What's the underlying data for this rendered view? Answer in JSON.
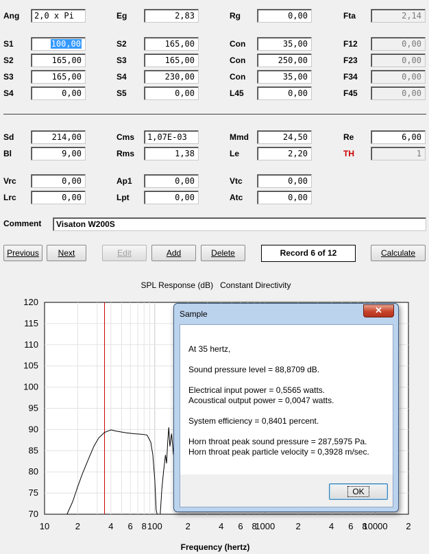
{
  "form": {
    "rows": [
      [
        {
          "label": "Ang",
          "value": "2,0 x Pi",
          "align": "left"
        },
        {
          "label": "Eg",
          "value": "2,83"
        },
        {
          "label": "Rg",
          "value": "0,00"
        },
        {
          "label": "Fta",
          "value": "2,14",
          "readonly": true
        }
      ],
      [
        {
          "label": "S1",
          "value": "100,00",
          "selected": true
        },
        {
          "label": "S2",
          "value": "165,00"
        },
        {
          "label": "Con",
          "value": "35,00"
        },
        {
          "label": "F12",
          "value": "0,00",
          "readonly": true
        }
      ],
      [
        {
          "label": "S2",
          "value": "165,00"
        },
        {
          "label": "S3",
          "value": "165,00"
        },
        {
          "label": "Con",
          "value": "250,00"
        },
        {
          "label": "F23",
          "value": "0,00",
          "readonly": true
        }
      ],
      [
        {
          "label": "S3",
          "value": "165,00"
        },
        {
          "label": "S4",
          "value": "230,00"
        },
        {
          "label": "Con",
          "value": "35,00"
        },
        {
          "label": "F34",
          "value": "0,00",
          "readonly": true
        }
      ],
      [
        {
          "label": "S4",
          "value": "0,00"
        },
        {
          "label": "S5",
          "value": "0,00"
        },
        {
          "label": "L45",
          "value": "0,00"
        },
        {
          "label": "F45",
          "value": "0,00",
          "readonly": true
        }
      ],
      [
        {
          "label": "Sd",
          "value": "214,00"
        },
        {
          "label": "Cms",
          "value": "1,07E-03",
          "align": "left"
        },
        {
          "label": "Mmd",
          "value": "24,50"
        },
        {
          "label": "Re",
          "value": "6,00"
        }
      ],
      [
        {
          "label": "Bl",
          "value": "9,00"
        },
        {
          "label": "Rms",
          "value": "1,38"
        },
        {
          "label": "Le",
          "value": "2,20"
        },
        {
          "label": "TH",
          "value": "1",
          "readonly": true,
          "red": true
        }
      ],
      [
        {
          "label": "Vrc",
          "value": "0,00"
        },
        {
          "label": "Ap1",
          "value": "0,00"
        },
        {
          "label": "Vtc",
          "value": "0,00"
        }
      ],
      [
        {
          "label": "Lrc",
          "value": "0,00"
        },
        {
          "label": "Lpt",
          "value": "0,00"
        },
        {
          "label": "Atc",
          "value": "0,00"
        }
      ]
    ],
    "comment_label": "Comment",
    "comment_value": "Visaton W200S"
  },
  "buttons": {
    "previous": "Previous",
    "next": "Next",
    "edit": "Edit",
    "add": "Add",
    "delete": "Delete",
    "record": "Record 6 of 12",
    "calculate": "Calculate"
  },
  "chart_data": {
    "type": "line",
    "title": "SPL Response (dB)   Constant Directivity",
    "xlabel": "Frequency (hertz)",
    "ylabel": "",
    "x_scale": "log",
    "xlim": [
      10,
      20000
    ],
    "ylim": [
      70,
      120
    ],
    "y_ticks": [
      120,
      115,
      110,
      105,
      100,
      95,
      90,
      85,
      80,
      75,
      70
    ],
    "x_tick_labels": [
      {
        "x": 10,
        "label": "10"
      },
      {
        "x": 20,
        "label": "2"
      },
      {
        "x": 40,
        "label": "4"
      },
      {
        "x": 60,
        "label": "6"
      },
      {
        "x": 80,
        "label": "8"
      },
      {
        "x": 100,
        "label": "100"
      },
      {
        "x": 200,
        "label": "2"
      },
      {
        "x": 400,
        "label": "4"
      },
      {
        "x": 600,
        "label": "6"
      },
      {
        "x": 800,
        "label": "8"
      },
      {
        "x": 1000,
        "label": "1000"
      },
      {
        "x": 2000,
        "label": "2"
      },
      {
        "x": 4000,
        "label": "4"
      },
      {
        "x": 6000,
        "label": "6"
      },
      {
        "x": 8000,
        "label": "8"
      },
      {
        "x": 10000,
        "label": "10000"
      },
      {
        "x": 20000,
        "label": "2"
      }
    ],
    "grid": true,
    "marker_frequency": 35,
    "marker_color": "#cc0000",
    "series": [
      {
        "color": "#000000",
        "points": [
          [
            16,
            70
          ],
          [
            18,
            73
          ],
          [
            20,
            76.5
          ],
          [
            22,
            79.5
          ],
          [
            25,
            83
          ],
          [
            28,
            86
          ],
          [
            31,
            88
          ],
          [
            35,
            89.3
          ],
          [
            40,
            89.9
          ],
          [
            45,
            89.6
          ],
          [
            55,
            89.2
          ],
          [
            65,
            89.0
          ],
          [
            75,
            88.9
          ],
          [
            85,
            88.7
          ],
          [
            92,
            87
          ],
          [
            96,
            84
          ],
          [
            100,
            78
          ],
          [
            103,
            71
          ],
          [
            105,
            70
          ]
        ]
      },
      {
        "color": "#000000",
        "points": [
          [
            112,
            70
          ],
          [
            116,
            76
          ],
          [
            120,
            80
          ],
          [
            125,
            84
          ],
          [
            128,
            82
          ],
          [
            131,
            87
          ],
          [
            134,
            90.5
          ],
          [
            137,
            86
          ],
          [
            142,
            89
          ],
          [
            148,
            84
          ],
          [
            154,
            88
          ],
          [
            160,
            86
          ]
        ]
      }
    ]
  },
  "dialog": {
    "title": "Sample",
    "close_glyph": "✕",
    "lines": [
      "At 35 hertz,",
      "Sound pressure level = 88,8709 dB.",
      "Electrical input power = 0,5565 watts.",
      "Acoustical output power = 0,0047 watts.",
      "System efficiency = 0,8401 percent.",
      "Horn throat peak sound pressure = 287,5975 Pa.",
      "Horn throat peak particle velocity = 0,3928 m/sec."
    ],
    "ok": "OK"
  }
}
